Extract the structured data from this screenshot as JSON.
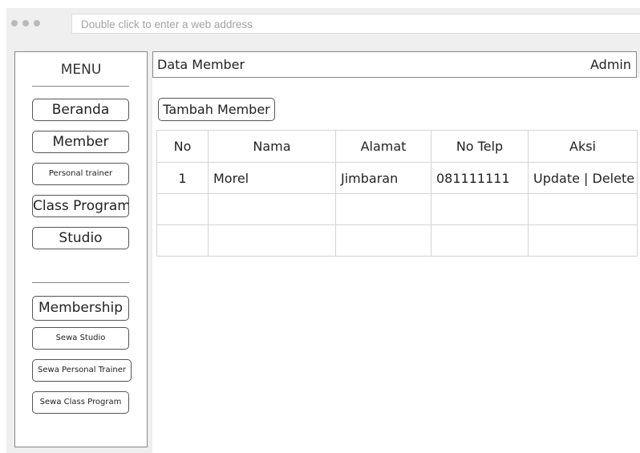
{
  "browser": {
    "address_placeholder": "Double click to enter a web address"
  },
  "sidebar": {
    "title": "MENU",
    "items": [
      {
        "label": "Beranda"
      },
      {
        "label": "Member"
      },
      {
        "label": "Personal trainer"
      },
      {
        "label": "Class Program"
      },
      {
        "label": "Studio"
      }
    ],
    "items2": [
      {
        "label": "Membership"
      },
      {
        "label": "Sewa Studio"
      },
      {
        "label": "Sewa Personal Trainer"
      },
      {
        "label": "Sewa Class Program"
      }
    ]
  },
  "header": {
    "title": "Data Member",
    "user": "Admin"
  },
  "main": {
    "add_button": "Tambah Member",
    "table": {
      "headers": [
        "No",
        "Nama",
        "Alamat",
        "No Telp",
        "Aksi"
      ],
      "rows": [
        {
          "no": "1",
          "nama": "Morel",
          "alamat": "Jimbaran",
          "telp": "081111111",
          "aksi": "Update | Delete"
        },
        {
          "no": "",
          "nama": "",
          "alamat": "",
          "telp": "",
          "aksi": ""
        },
        {
          "no": "",
          "nama": "",
          "alamat": "",
          "telp": "",
          "aksi": ""
        }
      ]
    }
  }
}
